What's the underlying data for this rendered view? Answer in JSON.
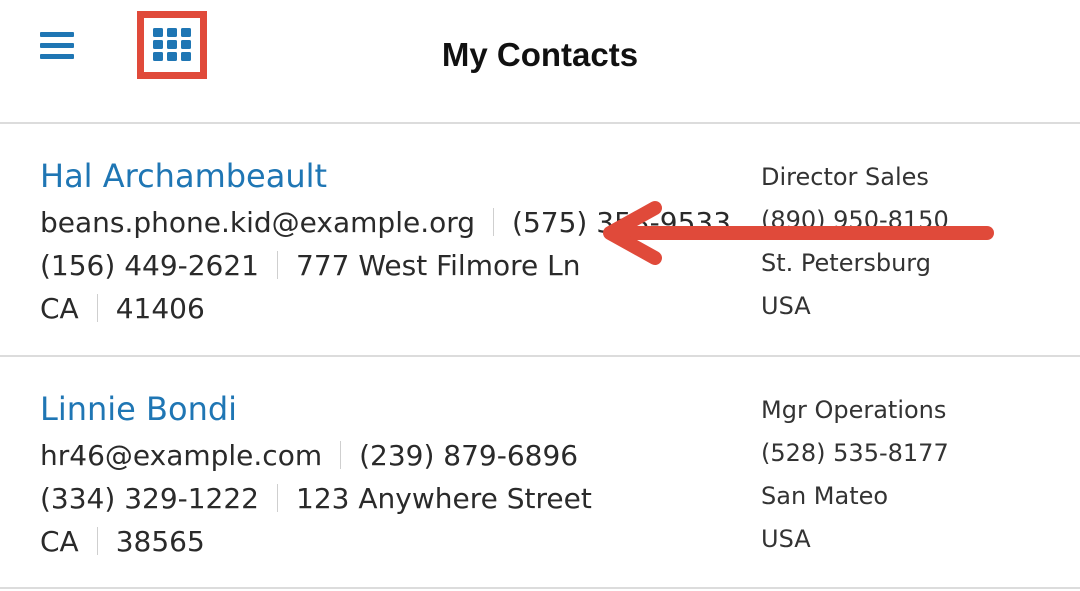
{
  "header": {
    "title": "My Contacts",
    "menu_icon": "hamburger-menu-icon",
    "grid_icon": "app-grid-icon"
  },
  "colors": {
    "accent": "#1f76b4",
    "highlight": "#e04a3a",
    "divider": "#dcdcdc"
  },
  "contacts": [
    {
      "name": "Hal Archambeault",
      "email": "beans.phone.kid@example.org",
      "phone1": "(575) 353-9533",
      "phone2": "(156) 449-2621",
      "street": "777 West Filmore Ln",
      "state": "CA",
      "zip": "41406",
      "title": "Director Sales",
      "phone3": "(890) 950-8150",
      "city": "St. Petersburg",
      "country": "USA"
    },
    {
      "name": "Linnie Bondi",
      "email": "hr46@example.com",
      "phone1": "(239) 879-6896",
      "phone2": "(334) 329-1222",
      "street": "123 Anywhere Street",
      "state": "CA",
      "zip": "38565",
      "title": "Mgr Operations",
      "phone3": "(528) 535-8177",
      "city": "San Mateo",
      "country": "USA"
    }
  ]
}
